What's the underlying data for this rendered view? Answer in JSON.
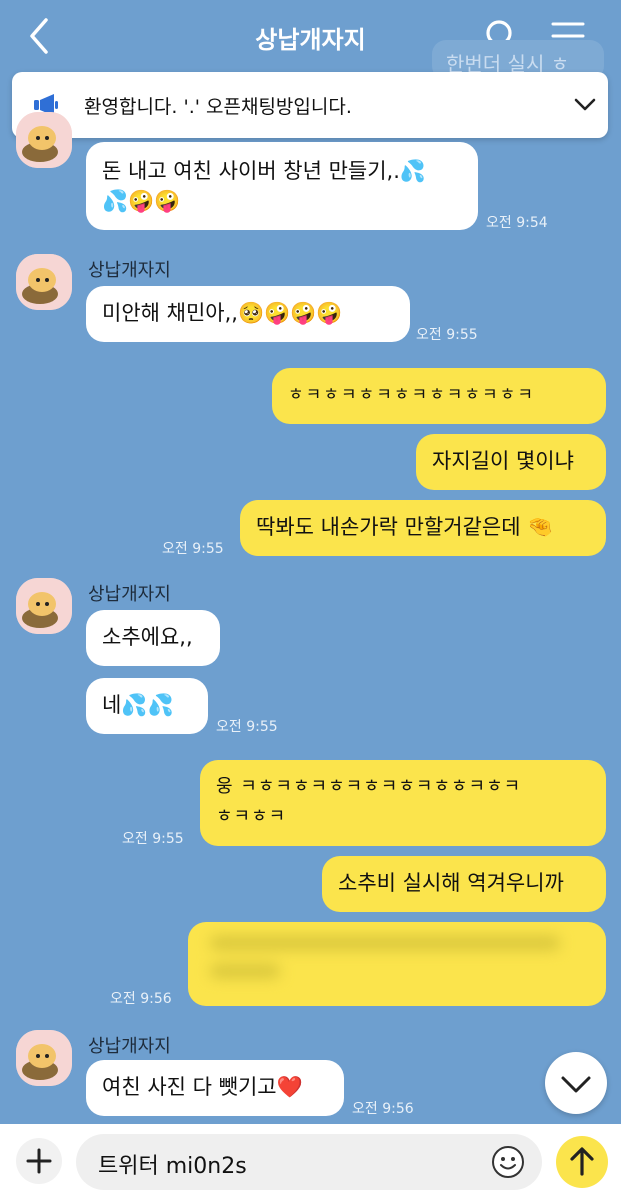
{
  "header": {
    "title": "상납개자지",
    "back_icon": "chevron-left-icon",
    "search_icon": "search-icon",
    "menu_icon": "hamburger-menu-icon"
  },
  "peek_text": "한번더 실시 ㅎ",
  "notice": {
    "icon": "megaphone-icon",
    "text": "환영합니다. '.' 오픈채팅방입니다."
  },
  "messages": [
    {
      "side": "in",
      "lines": [
        "돈 내고 여친 사이버 창년 만들기,.💦",
        "💦🤪🤪"
      ],
      "time": "오전 9:54"
    },
    {
      "side": "in",
      "sender": "상납개자지",
      "text": "미안해 채민아,,🥺🤪🤪🤪",
      "time": "오전 9:55"
    },
    {
      "side": "out",
      "text": "ㅎㅋㅎㅋㅎㅋㅎㅋㅎㅋㅎㅋㅎㅋ"
    },
    {
      "side": "out",
      "text": "자지길이 몇이냐"
    },
    {
      "side": "out",
      "text": "딱봐도 내손가락 만할거같은데 🤏",
      "time": "오전 9:55"
    },
    {
      "side": "in",
      "sender": "상납개자지",
      "text": "소추에요,,"
    },
    {
      "side": "in",
      "text": "네💦💦",
      "time": "오전 9:55"
    },
    {
      "side": "out",
      "lines": [
        "웅 ㅋㅎㅋㅎㅋㅎㅋㅎㅋㅎㅋㅎㅎㅋㅎㅋ",
        "ㅎㅋㅎㅋ"
      ],
      "time": "오전 9:55"
    },
    {
      "side": "out",
      "text": "소추비 실시해 역겨우니까"
    },
    {
      "side": "out",
      "text": "",
      "blurred": true,
      "time": "오전 9:56"
    },
    {
      "side": "in",
      "sender": "상납개자지",
      "text": "여친 사진 다 뺏기고❤️",
      "time": "오전 9:56"
    }
  ],
  "composer": {
    "plus_icon": "plus-icon",
    "input_value": "트위터 mi0n2s",
    "emoji_icon": "smiley-icon",
    "send_icon": "arrow-up-icon"
  },
  "scroll_down_icon": "chevron-down-icon",
  "colors": {
    "background": "#6e9fcf",
    "outgoing_bubble": "#fbe44c",
    "incoming_bubble": "#ffffff"
  }
}
